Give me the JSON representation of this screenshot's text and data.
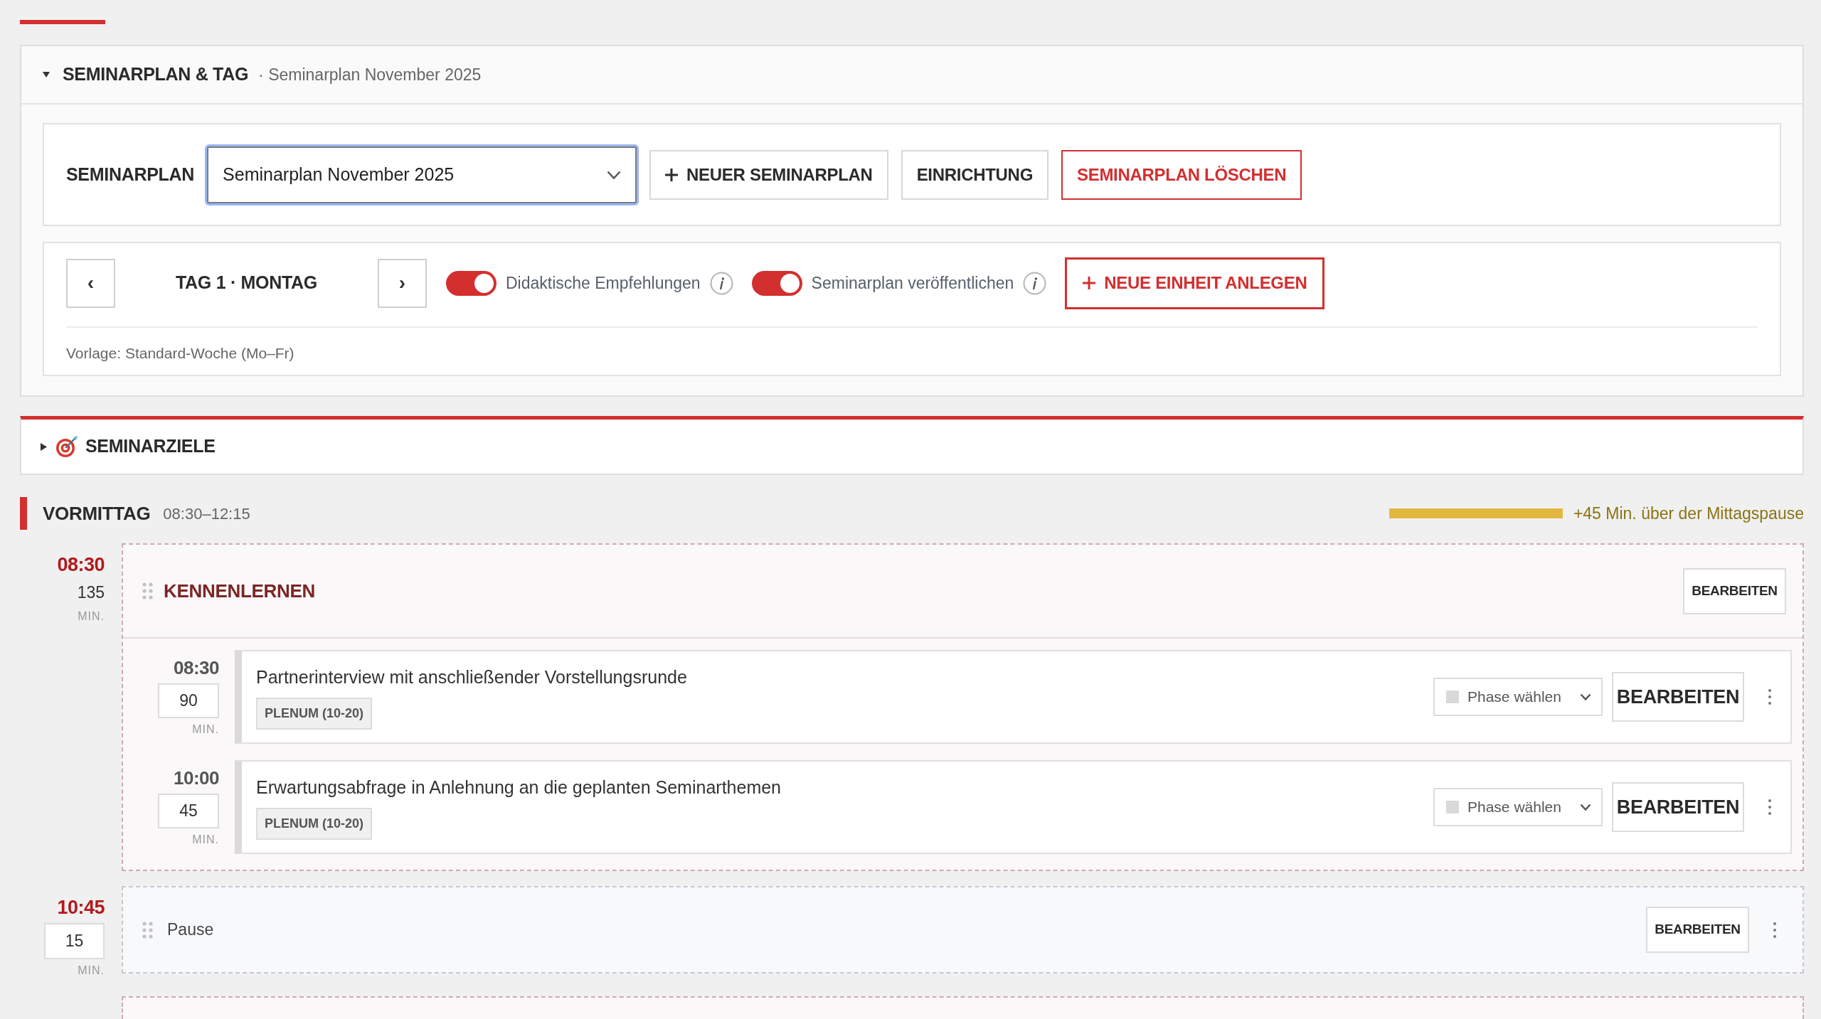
{
  "plan_panel": {
    "title": "SEMINARPLAN & TAG",
    "subtitle": "· Seminarplan November 2025",
    "expanded": true,
    "plan_label": "SEMINARPLAN",
    "plan_select": {
      "value": "Seminarplan November 2025"
    },
    "plan_buttons": [
      {
        "label": "NEUER SEMINARPLAN",
        "kind": "add"
      },
      {
        "label": "EINRICHTUNG",
        "kind": "plain"
      },
      {
        "label": "SEMINARPLAN LÖSCHEN",
        "kind": "danger"
      }
    ],
    "day_nav": {
      "previous": "‹",
      "day": "TAG 1 · MONTAG",
      "next": "›"
    },
    "toggles": [
      {
        "label": "Didaktische Empfehlungen",
        "on": true
      },
      {
        "label": "Seminarplan veröffentlichen",
        "on": true
      }
    ],
    "add_unit_button": {
      "label": "NEUE EINHEIT ANLEGEN",
      "kind": "add_primary"
    },
    "template_note": "Vorlage: Standard-Woche (Mo–Fr)"
  },
  "goals_panel": {
    "title": "SEMINARZIELE",
    "expanded": false
  },
  "section": {
    "title": "VORMITTAG",
    "time_range": "08:30–12:15",
    "overtime_note": "+45 Min. über der Mittagspause"
  },
  "blocks": [
    {
      "kind": "group",
      "start": "08:30",
      "duration": "135",
      "unit": "MIN.",
      "title": "KENNENLERNEN",
      "edit_label": "BEARBEITEN",
      "units": [
        {
          "start": "08:30",
          "duration": "90",
          "unit": "MIN.",
          "title": "Partnerinterview mit anschließender Vorstellungsrunde",
          "tag": "PLENUM (10-20)",
          "phase": "Phase wählen",
          "edit_label": "BEARBEITEN"
        },
        {
          "start": "10:00",
          "duration": "45",
          "unit": "MIN.",
          "title": "Erwartungsabfrage in Anlehnung an die geplanten Seminarthemen",
          "tag": "PLENUM (10-20)",
          "phase": "Phase wählen",
          "edit_label": "BEARBEITEN"
        }
      ]
    },
    {
      "kind": "break",
      "start": "10:45",
      "duration": "15",
      "unit": "MIN.",
      "title": "Pause",
      "edit_label": "BEARBEITEN"
    },
    {
      "kind": "group"
    }
  ]
}
